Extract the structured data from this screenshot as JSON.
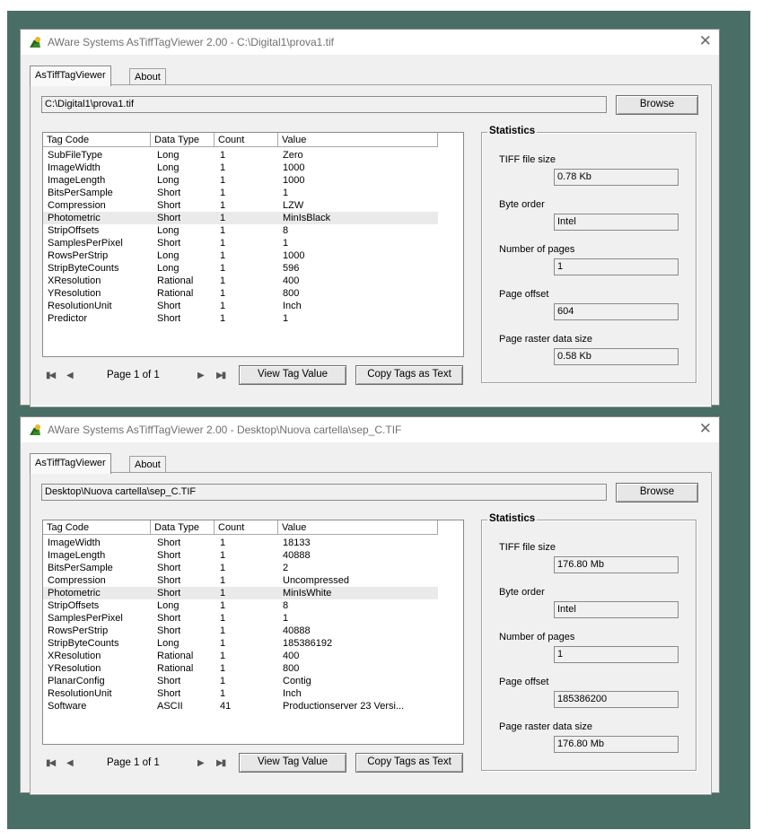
{
  "windows": [
    {
      "title": "AWare Systems  AsTiffTagViewer  2.00  -  C:\\Digital1\\prova1.tif",
      "tabs": [
        "AsTiffTagViewer",
        "About"
      ],
      "path": "C:\\Digital1\\prova1.tif",
      "browse_label": "Browse",
      "columns": [
        "Tag Code",
        "Data Type",
        "Count",
        "Value"
      ],
      "rows": [
        [
          "SubFileType",
          "Long",
          "1",
          "Zero"
        ],
        [
          "ImageWidth",
          "Long",
          "1",
          "1000"
        ],
        [
          "ImageLength",
          "Long",
          "1",
          "1000"
        ],
        [
          "BitsPerSample",
          "Short",
          "1",
          "1"
        ],
        [
          "Compression",
          "Short",
          "1",
          "LZW"
        ],
        [
          "Photometric",
          "Short",
          "1",
          "MinIsBlack"
        ],
        [
          "StripOffsets",
          "Long",
          "1",
          "8"
        ],
        [
          "SamplesPerPixel",
          "Short",
          "1",
          "1"
        ],
        [
          "RowsPerStrip",
          "Long",
          "1",
          "1000"
        ],
        [
          "StripByteCounts",
          "Long",
          "1",
          "596"
        ],
        [
          "XResolution",
          "Rational",
          "1",
          "400"
        ],
        [
          "YResolution",
          "Rational",
          "1",
          "800"
        ],
        [
          "ResolutionUnit",
          "Short",
          "1",
          "Inch"
        ],
        [
          "Predictor",
          "Short",
          "1",
          "1"
        ]
      ],
      "selected_row": 5,
      "page_label": "Page 1 of 1",
      "view_tag_label": "View Tag Value",
      "copy_tags_label": "Copy Tags as Text",
      "statistics": {
        "legend": "Statistics",
        "items": [
          {
            "label": "TIFF file size",
            "value": "0.78 Kb"
          },
          {
            "label": "Byte order",
            "value": "Intel"
          },
          {
            "label": "Number of pages",
            "value": "1"
          },
          {
            "label": "Page offset",
            "value": "604"
          },
          {
            "label": "Page raster data size",
            "value": "0.58 Kb"
          }
        ]
      }
    },
    {
      "title": "AWare Systems  AsTiffTagViewer  2.00  -  Desktop\\Nuova cartella\\sep_C.TIF",
      "tabs": [
        "AsTiffTagViewer",
        "About"
      ],
      "path": "Desktop\\Nuova cartella\\sep_C.TIF",
      "browse_label": "Browse",
      "columns": [
        "Tag Code",
        "Data Type",
        "Count",
        "Value"
      ],
      "rows": [
        [
          "ImageWidth",
          "Short",
          "1",
          "18133"
        ],
        [
          "ImageLength",
          "Short",
          "1",
          "40888"
        ],
        [
          "BitsPerSample",
          "Short",
          "1",
          "2"
        ],
        [
          "Compression",
          "Short",
          "1",
          "Uncompressed"
        ],
        [
          "Photometric",
          "Short",
          "1",
          "MinIsWhite"
        ],
        [
          "StripOffsets",
          "Long",
          "1",
          "8"
        ],
        [
          "SamplesPerPixel",
          "Short",
          "1",
          "1"
        ],
        [
          "RowsPerStrip",
          "Short",
          "1",
          "40888"
        ],
        [
          "StripByteCounts",
          "Long",
          "1",
          "185386192"
        ],
        [
          "XResolution",
          "Rational",
          "1",
          "400"
        ],
        [
          "YResolution",
          "Rational",
          "1",
          "800"
        ],
        [
          "PlanarConfig",
          "Short",
          "1",
          "Contig"
        ],
        [
          "ResolutionUnit",
          "Short",
          "1",
          "Inch"
        ],
        [
          "Software",
          "ASCII",
          "41",
          "Productionserver 23 Versi..."
        ]
      ],
      "selected_row": 4,
      "page_label": "Page 1 of 1",
      "view_tag_label": "View Tag Value",
      "copy_tags_label": "Copy Tags as Text",
      "statistics": {
        "legend": "Statistics",
        "items": [
          {
            "label": "TIFF file size",
            "value": "176.80 Mb"
          },
          {
            "label": "Byte order",
            "value": "Intel"
          },
          {
            "label": "Number of pages",
            "value": "1"
          },
          {
            "label": "Page offset",
            "value": "185386200"
          },
          {
            "label": "Page raster data size",
            "value": "176.80 Mb"
          }
        ]
      }
    }
  ],
  "icons": {
    "app": "app-icon",
    "close": "close-icon",
    "first": "first-page-icon",
    "prev": "previous-page-icon",
    "next": "next-page-icon",
    "last": "last-page-icon"
  },
  "colors": {
    "desktop": "#486e66",
    "window": "#f0f0f0",
    "selected_row": "#eaeaea"
  }
}
